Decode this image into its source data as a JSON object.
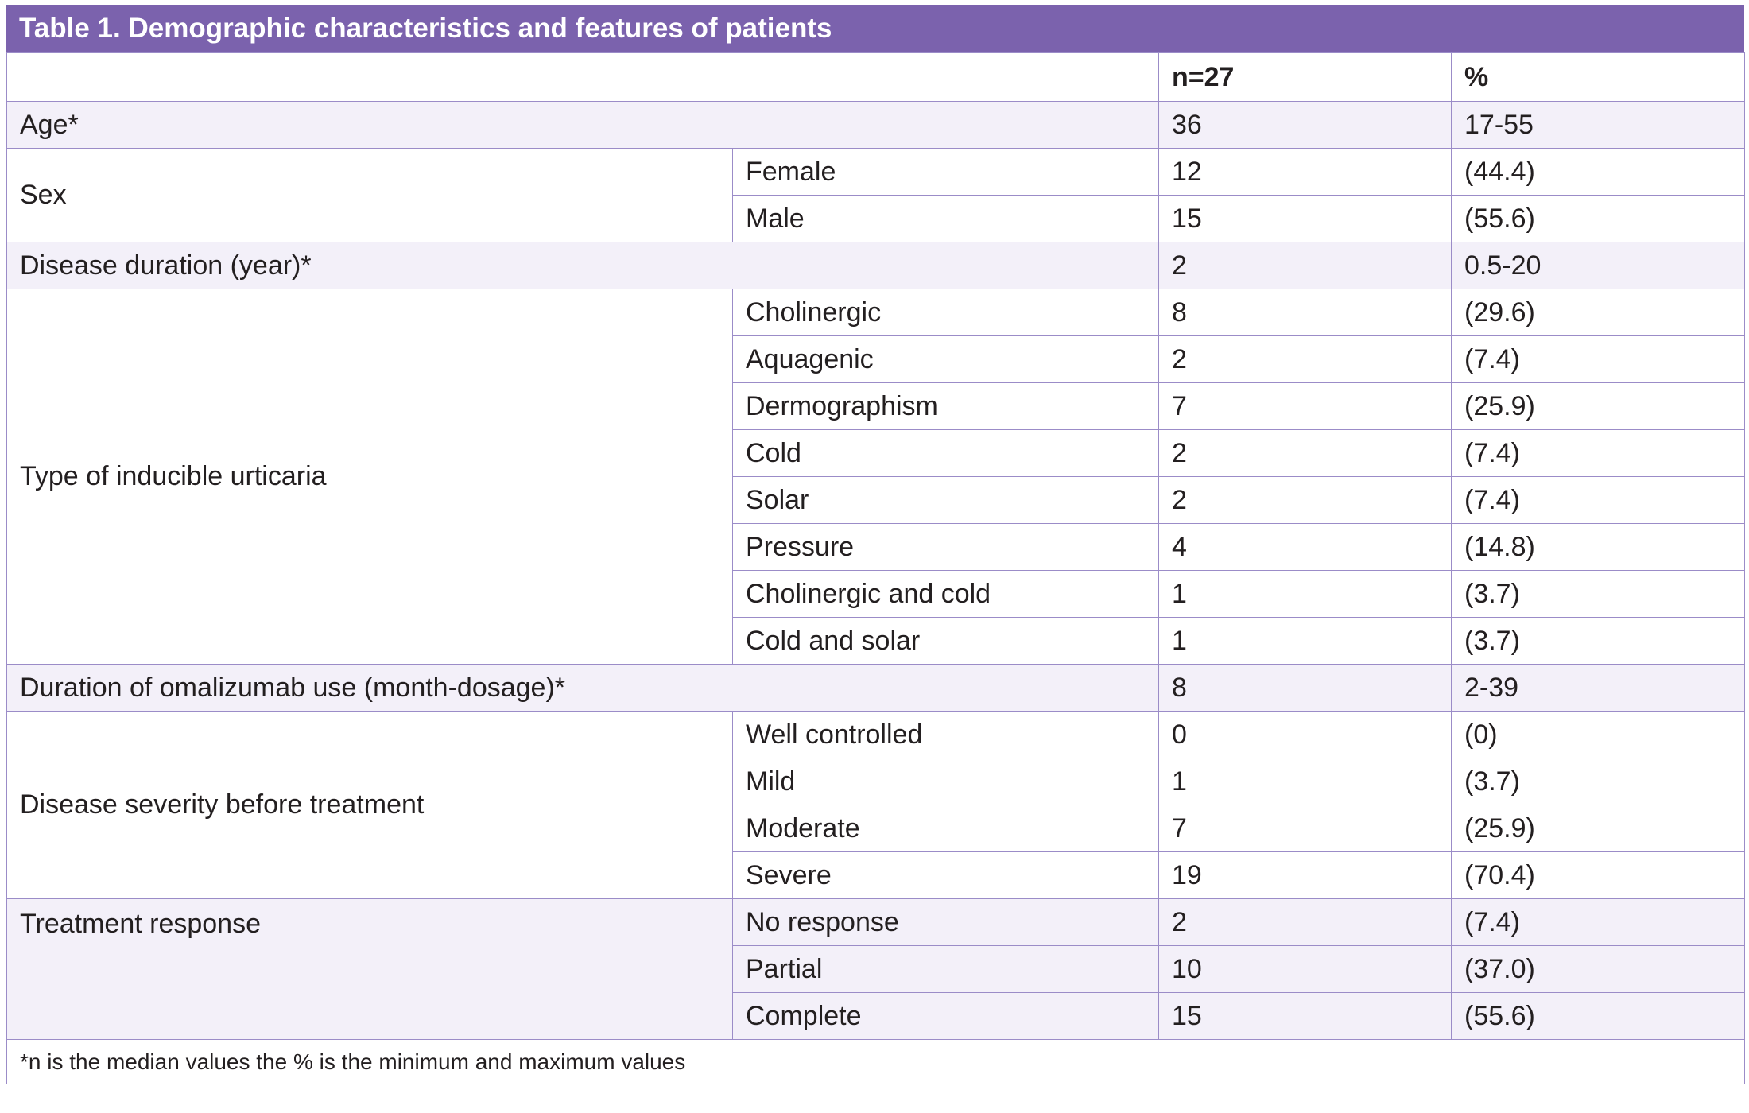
{
  "table": {
    "title": "Table 1. Demographic characteristics and features of patients",
    "header": {
      "col_n": "n=27",
      "col_pct": "%"
    },
    "age": {
      "label": "Age*",
      "n": "36",
      "pct": "17-55"
    },
    "sex": {
      "label": "Sex",
      "rows": [
        {
          "label": "Female",
          "n": "12",
          "pct": "(44.4)"
        },
        {
          "label": "Male",
          "n": "15",
          "pct": "(55.6)"
        }
      ]
    },
    "disease_duration": {
      "label": "Disease duration (year)*",
      "n": "2",
      "pct": "0.5-20"
    },
    "urticaria_type": {
      "label": "Type of inducible urticaria",
      "rows": [
        {
          "label": "Cholinergic",
          "n": "8",
          "pct": "(29.6)"
        },
        {
          "label": "Aquagenic",
          "n": "2",
          "pct": "(7.4)"
        },
        {
          "label": "Dermographism",
          "n": "7",
          "pct": "(25.9)"
        },
        {
          "label": "Cold",
          "n": "2",
          "pct": "(7.4)"
        },
        {
          "label": "Solar",
          "n": "2",
          "pct": "(7.4)"
        },
        {
          "label": "Pressure",
          "n": "4",
          "pct": "(14.8)"
        },
        {
          "label": "Cholinergic and cold",
          "n": "1",
          "pct": "(3.7)"
        },
        {
          "label": "Cold and solar",
          "n": "1",
          "pct": "(3.7)"
        }
      ]
    },
    "omalizumab_duration": {
      "label": "Duration of omalizumab use (month-dosage)*",
      "n": "8",
      "pct": "2-39"
    },
    "severity": {
      "label": "Disease severity before treatment",
      "rows": [
        {
          "label": "Well controlled",
          "n": "0",
          "pct": "(0)"
        },
        {
          "label": "Mild",
          "n": "1",
          "pct": "(3.7)"
        },
        {
          "label": "Moderate",
          "n": "7",
          "pct": "(25.9)"
        },
        {
          "label": "Severe",
          "n": "19",
          "pct": "(70.4)"
        }
      ]
    },
    "response": {
      "label": "Treatment response",
      "rows": [
        {
          "label": "No response",
          "n": "2",
          "pct": "(7.4)"
        },
        {
          "label": "Partial",
          "n": "10",
          "pct": "(37.0)"
        },
        {
          "label": "Complete",
          "n": "15",
          "pct": "(55.6)"
        }
      ]
    },
    "footnote": "*n is the median values the % is the minimum and maximum values"
  },
  "colors": {
    "title_bg": "#7b62ad",
    "border": "#9b8cc8",
    "row_shade": "#f3f0f9",
    "text": "#231f20"
  }
}
